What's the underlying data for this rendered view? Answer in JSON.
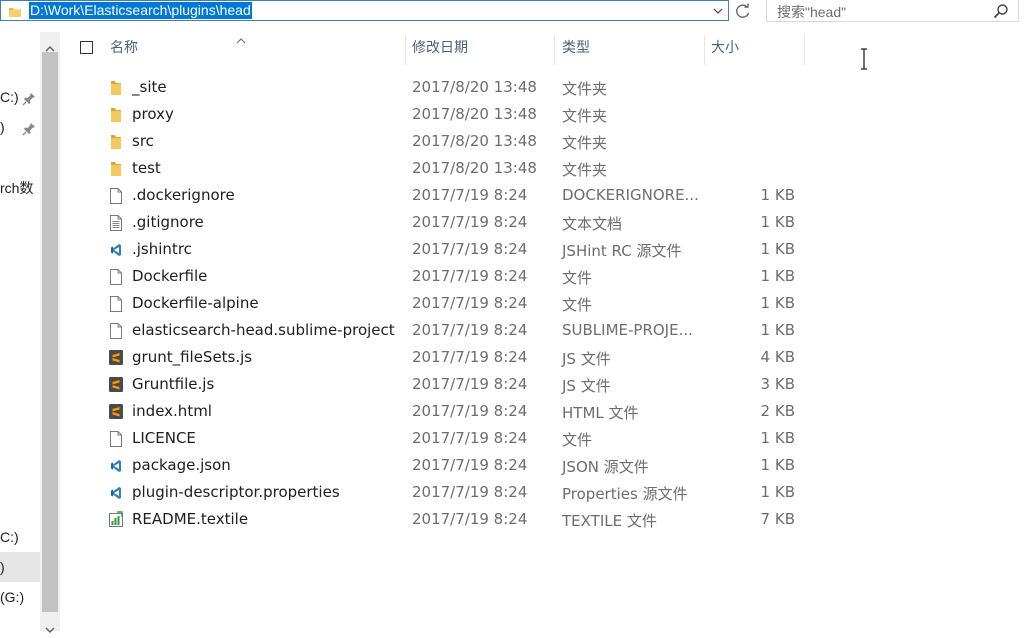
{
  "address_bar": {
    "path": "D:\\Work\\Elasticsearch\\plugins\\head"
  },
  "search": {
    "placeholder": "搜索\"head\""
  },
  "nav": {
    "items": [
      {
        "label": "C:)",
        "pinned": true
      },
      {
        "label": ")",
        "pinned": true
      },
      {
        "label": "rch数",
        "pinned": false
      },
      {
        "label": "C:)",
        "pinned": false
      },
      {
        "label": ")",
        "pinned": false,
        "selected": true
      },
      {
        "label": " (G:)",
        "pinned": false
      }
    ]
  },
  "columns": {
    "name": "名称",
    "date": "修改日期",
    "type": "类型",
    "size": "大小"
  },
  "colors": {
    "selection": "#0078d7",
    "folder": "#e8b84a",
    "vscode": "#2f7fc1",
    "sublime": "#4a4a4a"
  },
  "files": [
    {
      "name": "_site",
      "date": "2017/8/20 13:48",
      "type": "文件夹",
      "size": "",
      "icon": "folder"
    },
    {
      "name": "proxy",
      "date": "2017/8/20 13:48",
      "type": "文件夹",
      "size": "",
      "icon": "folder"
    },
    {
      "name": "src",
      "date": "2017/8/20 13:48",
      "type": "文件夹",
      "size": "",
      "icon": "folder"
    },
    {
      "name": "test",
      "date": "2017/8/20 13:48",
      "type": "文件夹",
      "size": "",
      "icon": "folder"
    },
    {
      "name": ".dockerignore",
      "date": "2017/7/19 8:24",
      "type": "DOCKERIGNORE...",
      "size": "1 KB",
      "icon": "file"
    },
    {
      "name": ".gitignore",
      "date": "2017/7/19 8:24",
      "type": "文本文档",
      "size": "1 KB",
      "icon": "text"
    },
    {
      "name": ".jshintrc",
      "date": "2017/7/19 8:24",
      "type": "JSHint RC 源文件",
      "size": "1 KB",
      "icon": "vscode"
    },
    {
      "name": "Dockerfile",
      "date": "2017/7/19 8:24",
      "type": "文件",
      "size": "1 KB",
      "icon": "file"
    },
    {
      "name": "Dockerfile-alpine",
      "date": "2017/7/19 8:24",
      "type": "文件",
      "size": "1 KB",
      "icon": "file"
    },
    {
      "name": "elasticsearch-head.sublime-project",
      "date": "2017/7/19 8:24",
      "type": "SUBLIME-PROJE...",
      "size": "1 KB",
      "icon": "file"
    },
    {
      "name": "grunt_fileSets.js",
      "date": "2017/7/19 8:24",
      "type": "JS 文件",
      "size": "4 KB",
      "icon": "sublime"
    },
    {
      "name": "Gruntfile.js",
      "date": "2017/7/19 8:24",
      "type": "JS 文件",
      "size": "3 KB",
      "icon": "sublime"
    },
    {
      "name": "index.html",
      "date": "2017/7/19 8:24",
      "type": "HTML 文件",
      "size": "2 KB",
      "icon": "sublime"
    },
    {
      "name": "LICENCE",
      "date": "2017/7/19 8:24",
      "type": "文件",
      "size": "1 KB",
      "icon": "file"
    },
    {
      "name": "package.json",
      "date": "2017/7/19 8:24",
      "type": "JSON 源文件",
      "size": "1 KB",
      "icon": "vscode"
    },
    {
      "name": "plugin-descriptor.properties",
      "date": "2017/7/19 8:24",
      "type": "Properties 源文件",
      "size": "1 KB",
      "icon": "vscode"
    },
    {
      "name": "README.textile",
      "date": "2017/7/19 8:24",
      "type": "TEXTILE 文件",
      "size": "7 KB",
      "icon": "textile"
    }
  ]
}
